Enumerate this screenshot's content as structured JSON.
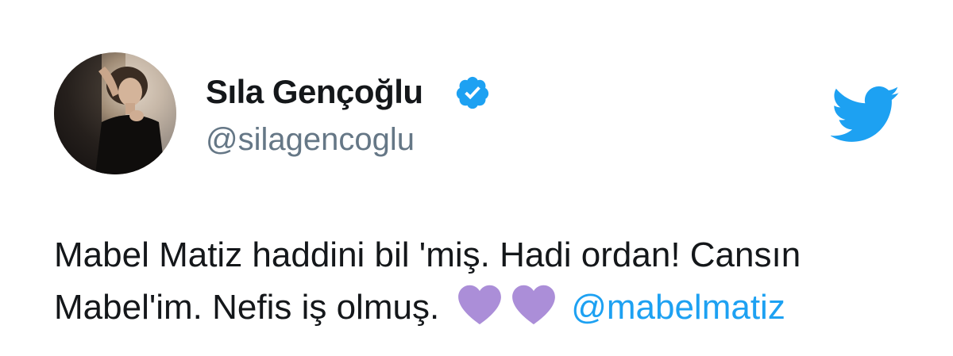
{
  "author": {
    "name": "Sıla Gençoğlu",
    "handle": "@silagencoglu",
    "verified": true,
    "avatar": "profile-photo"
  },
  "tweet": {
    "line1": "Mabel Matiz haddini bil 'miş. Hadi ordan! Cansın",
    "line2": "Mabel'im. Nefis iş olmuş.",
    "emoji": [
      "purple-heart",
      "purple-heart"
    ],
    "mention": "@mabelmatiz"
  },
  "icons": {
    "brand": "twitter-bird-icon",
    "badge": "verified-badge-icon"
  },
  "colors": {
    "twitter_blue": "#1da1f2",
    "verified_blue": "#1da1f2",
    "heart_purple": "#ab8ed8",
    "name_text": "#14171a",
    "handle_text": "#657786"
  }
}
